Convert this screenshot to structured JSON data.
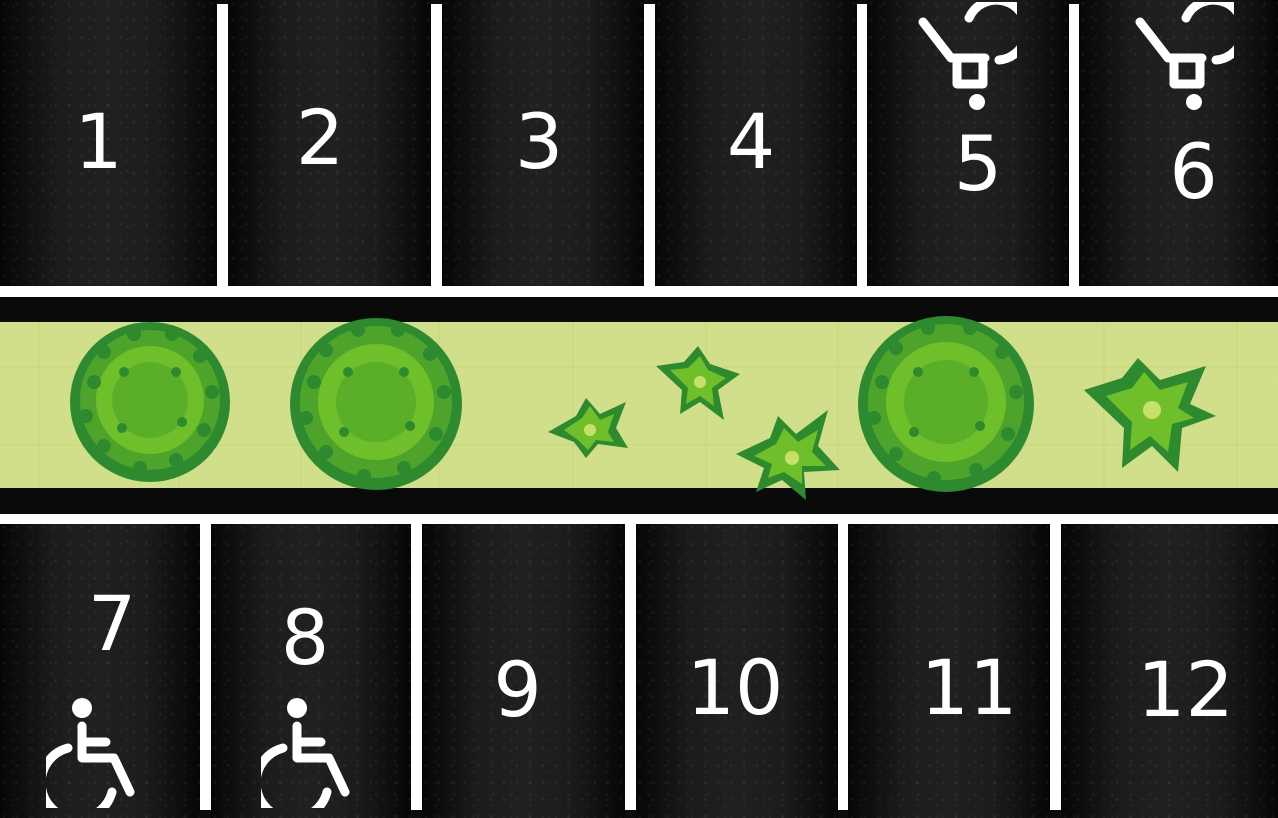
{
  "colors": {
    "asphalt": "#1a1a1a",
    "line": "#ffffff",
    "grass": "#a4c034",
    "tree_dark": "#2d8a2e",
    "tree_light": "#6fbf2a"
  },
  "top_row": [
    {
      "number": "1",
      "icon": "none"
    },
    {
      "number": "2",
      "icon": "none"
    },
    {
      "number": "3",
      "icon": "none"
    },
    {
      "number": "4",
      "icon": "none"
    },
    {
      "number": "5",
      "icon": "stroller-icon"
    },
    {
      "number": "6",
      "icon": "stroller-icon"
    }
  ],
  "bottom_row": [
    {
      "number": "7",
      "icon": "wheelchair-icon"
    },
    {
      "number": "8",
      "icon": "wheelchair-icon"
    },
    {
      "number": "9",
      "icon": "none"
    },
    {
      "number": "10",
      "icon": "none"
    },
    {
      "number": "11",
      "icon": "none"
    },
    {
      "number": "12",
      "icon": "none"
    }
  ]
}
